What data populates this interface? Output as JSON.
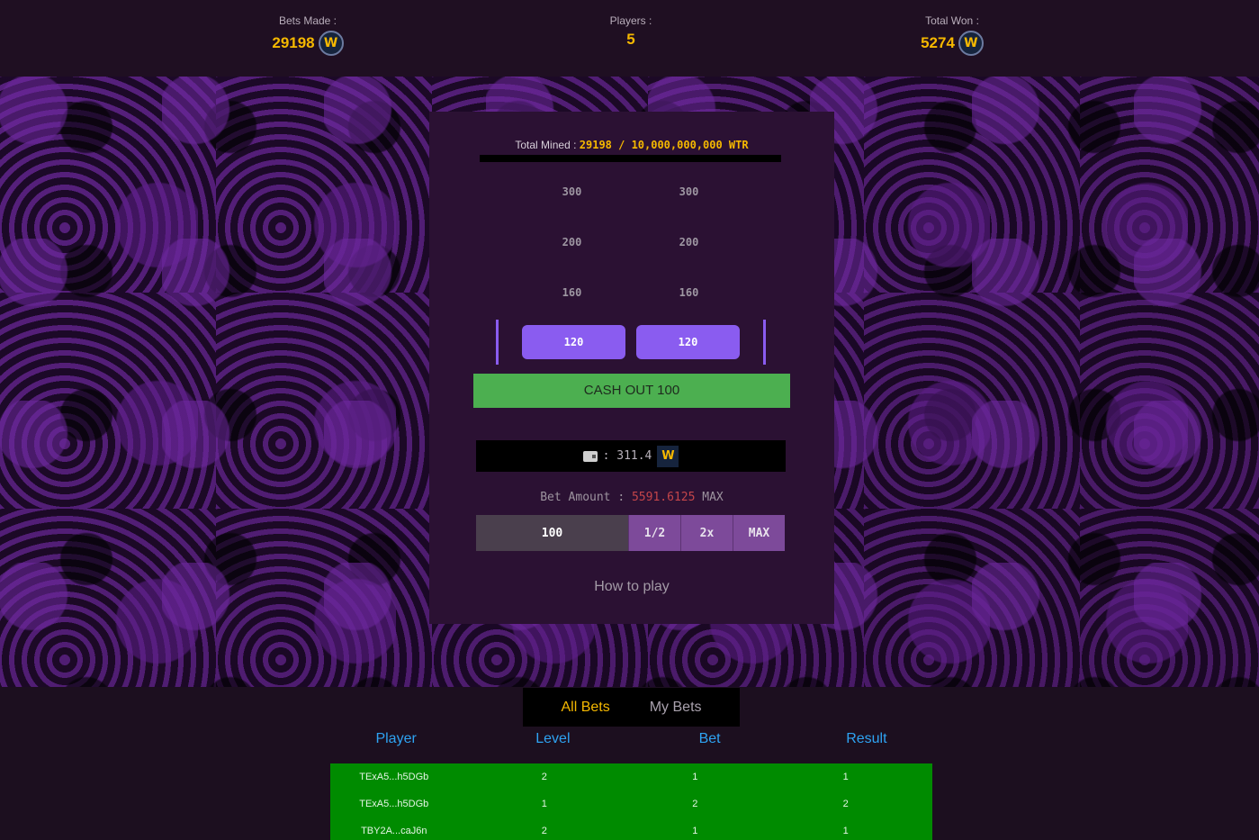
{
  "stats": {
    "bets_made_label": "Bets Made :",
    "bets_made_value": "29198",
    "players_label": "Players :",
    "players_value": "5",
    "total_won_label": "Total Won :",
    "total_won_value": "5274",
    "coin_glyph": "W",
    "coin_icon": "wtr-coin-icon"
  },
  "game": {
    "mined_label": "Total Mined :",
    "mined_value": "29198 / 10,000,000,000 WTR",
    "levels": [
      {
        "left": "300",
        "right": "300"
      },
      {
        "left": "200",
        "right": "200"
      },
      {
        "left": "160",
        "right": "160"
      }
    ],
    "current_left": "120",
    "current_right": "120",
    "cashout_label": "CASH OUT 100",
    "wallet_icon": "wallet-icon",
    "wallet_balance": ": 311.4",
    "bet_amount_label": "Bet Amount :",
    "bet_amount_max_value": "5591.6125",
    "bet_amount_max_label": "MAX",
    "bet_input_value": "100",
    "half_label": "1/2",
    "double_label": "2x",
    "max_label": "MAX",
    "how_to_play": "How to play"
  },
  "bets": {
    "tabs": [
      "All Bets",
      "My Bets"
    ],
    "columns": [
      "Player",
      "Level",
      "Bet",
      "Result"
    ],
    "rows": [
      {
        "player": "TExA5...h5DGb",
        "level": "2",
        "bet": "1",
        "result": "1"
      },
      {
        "player": "TExA5...h5DGb",
        "level": "1",
        "bet": "2",
        "result": "2"
      },
      {
        "player": "TBY2A...caJ6n",
        "level": "2",
        "bet": "1",
        "result": "1"
      }
    ]
  },
  "colors": {
    "accent_gold": "#f5b800",
    "tower_purple": "#8a5cf0",
    "cashout_green": "#4caf50",
    "row_green": "#008b00",
    "header_blue": "#2ea3f2"
  }
}
